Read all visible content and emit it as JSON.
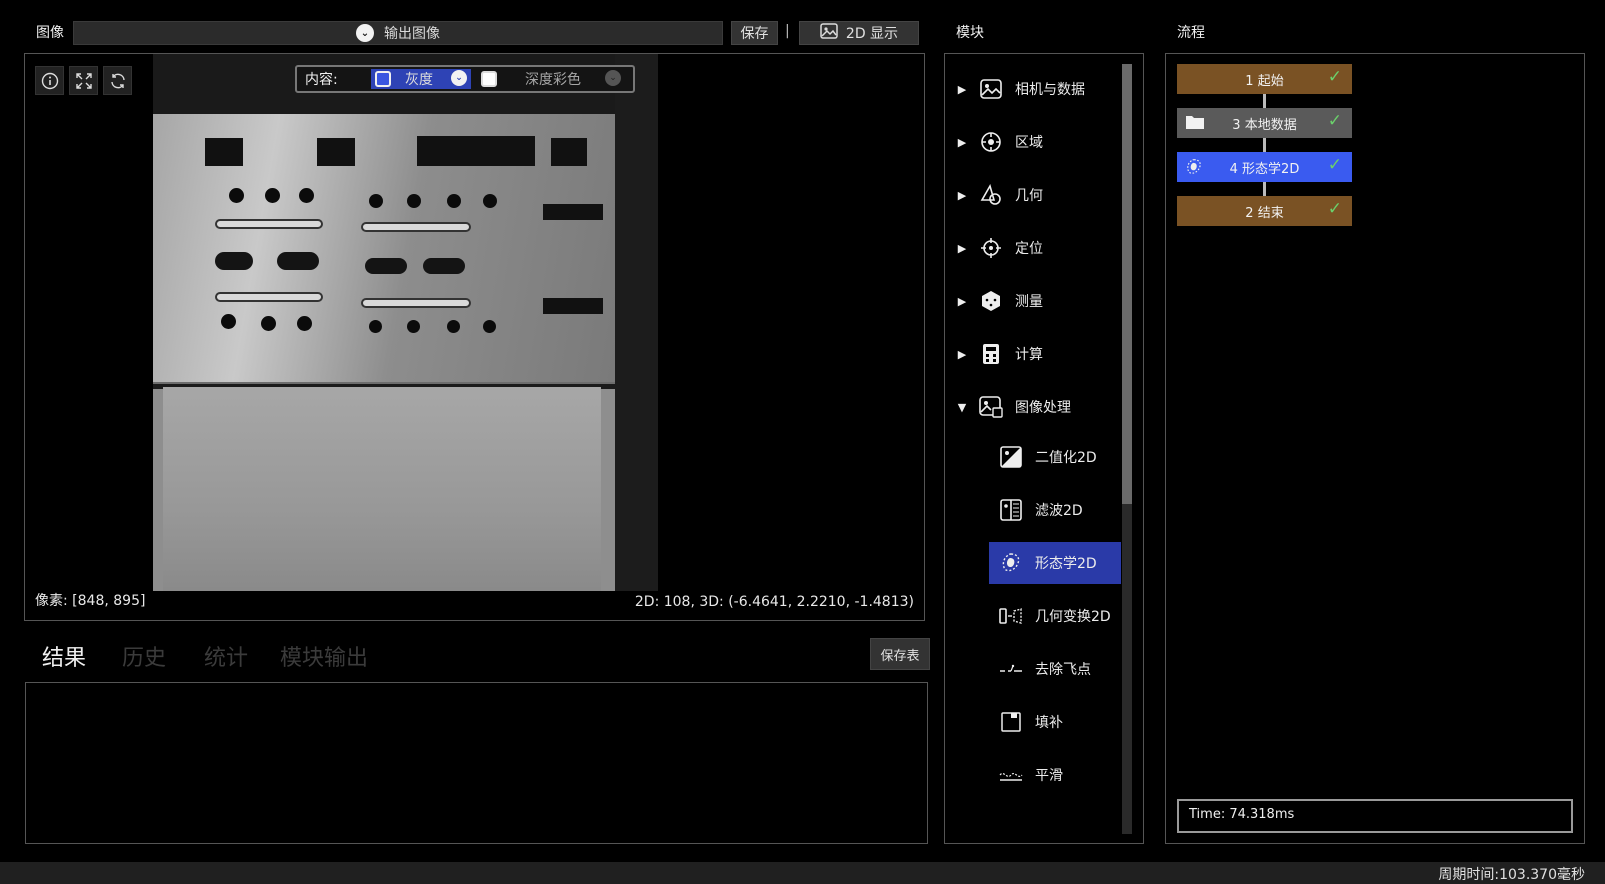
{
  "image_panel": {
    "title": "图像",
    "output_select": "输出图像",
    "save_label": "保存",
    "separator": "|",
    "display_2d_label": "2D 显示"
  },
  "viewer": {
    "content_label": "内容:",
    "gray_option": "灰度",
    "depth_option": "深度彩色",
    "pixel_readout": "像素: [848, 895]",
    "coord_readout": "2D: 108, 3D: (-6.4641, 2.2210, -1.4813)",
    "tool_icons": [
      "info-icon",
      "fit-view-icon",
      "refresh-icon"
    ]
  },
  "results": {
    "tabs": [
      "结果",
      "历史",
      "统计",
      "模块输出"
    ],
    "save_table_label": "保存表"
  },
  "modules": {
    "title": "模块",
    "categories": [
      {
        "label": "相机与数据",
        "icon": "image-icon",
        "expanded": false
      },
      {
        "label": "区域",
        "icon": "region-icon",
        "expanded": false
      },
      {
        "label": "几何",
        "icon": "geometry-icon",
        "expanded": false
      },
      {
        "label": "定位",
        "icon": "locate-icon",
        "expanded": false
      },
      {
        "label": "测量",
        "icon": "measure-icon",
        "expanded": false
      },
      {
        "label": "计算",
        "icon": "calculator-icon",
        "expanded": false
      },
      {
        "label": "图像处理",
        "icon": "image-processing-icon",
        "expanded": true
      }
    ],
    "sub_items": [
      {
        "label": "二值化2D",
        "icon": "binarize-icon"
      },
      {
        "label": "滤波2D",
        "icon": "filter-icon"
      },
      {
        "label": "形态学2D",
        "icon": "morphology-icon",
        "active": true
      },
      {
        "label": "几何变换2D",
        "icon": "transform-icon"
      },
      {
        "label": "去除飞点",
        "icon": "remove-outlier-icon"
      },
      {
        "label": "填补",
        "icon": "fill-icon"
      },
      {
        "label": "平滑",
        "icon": "smooth-icon"
      }
    ]
  },
  "flow": {
    "title": "流程",
    "nodes": [
      {
        "label": "1 起始",
        "color": "#7a5224",
        "status": "done"
      },
      {
        "label": "3 本地数据",
        "color": "#5a5a5a",
        "status": "done",
        "icon": "folder-icon"
      },
      {
        "label": "4 形态学2D",
        "color": "#3a5bf0",
        "status": "done",
        "icon": "morphology-icon"
      },
      {
        "label": "2 结束",
        "color": "#7a5224",
        "status": "done"
      }
    ],
    "time": "Time: 74.318ms"
  },
  "status_bar": {
    "cycle_time": "周期时间:103.370毫秒"
  },
  "colors": {
    "accent_blue": "#3a5bf0",
    "selected_module": "#2a3aa8",
    "node_brown": "#7a5224",
    "check_green": "#6bd06b"
  }
}
